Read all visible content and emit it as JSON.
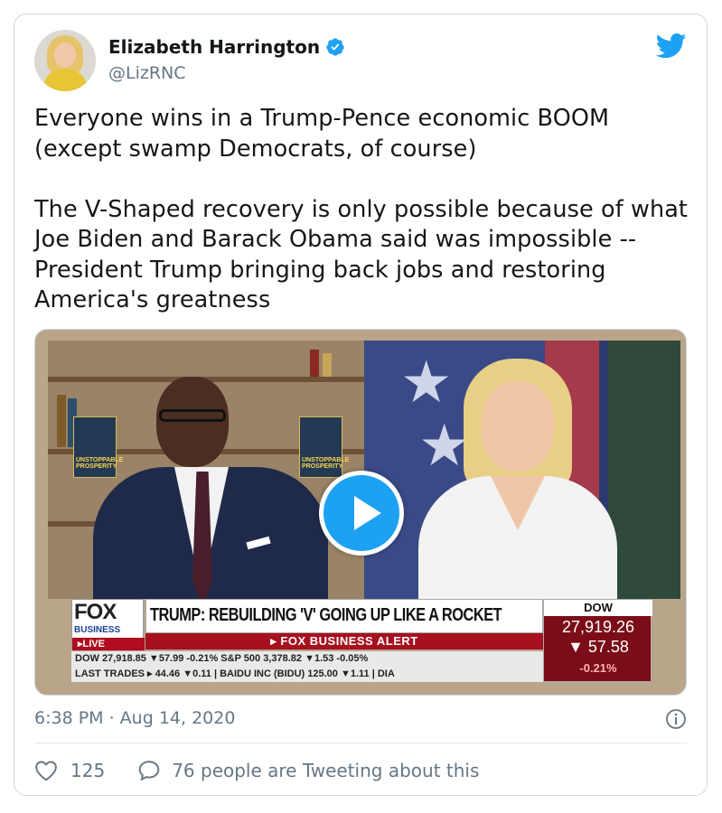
{
  "tweet": {
    "author": {
      "display_name": "Elizabeth Harrington",
      "handle": "@LizRNC",
      "verified": true
    },
    "text": "Everyone wins in a Trump-Pence economic BOOM\n(except swamp Democrats, of course)\n\nThe V-Shaped recovery is only possible because of what Joe Biden and Barack Obama said was impossible -- President Trump bringing back jobs and restoring America's greatness",
    "timestamp": "6:38 PM · Aug 14, 2020",
    "likes": "125",
    "tweeting_text": "76 people are Tweeting about this"
  },
  "video": {
    "book_label": "UNSTOPPABLE PROSPERITY",
    "chyron": {
      "network": "FOX",
      "network_sub": "BUSINESS",
      "live_label": "▸LIVE",
      "headline": "TRUMP: REBUILDING 'V' GOING UP LIKE A ROCKET",
      "alert": "▸ FOX BUSINESS ALERT",
      "dow_label": "DOW",
      "dow_value": "27,919.26",
      "dow_change": "▼ 57.58",
      "dow_pct": "-0.21%",
      "ticker_row1": "DOW    27,918.85 ▼57.99 -0.21%  S&P 500   3,378.82 ▼1.53 -0.05%",
      "ticker_row2": "LAST TRADES ▸ 44.46 ▼0.11 | BAIDU INC (BIDU) 125.00 ▼1.11 | DIA"
    }
  },
  "colors": {
    "twitter_blue": "#1da1f2",
    "secondary_text": "#657786",
    "fox_red": "#b10d1f"
  },
  "icons": {
    "brand": "twitter-bird-icon",
    "verified": "verified-badge-icon",
    "info": "info-icon",
    "like": "heart-icon",
    "reply": "speech-bubble-icon",
    "play": "play-icon"
  }
}
